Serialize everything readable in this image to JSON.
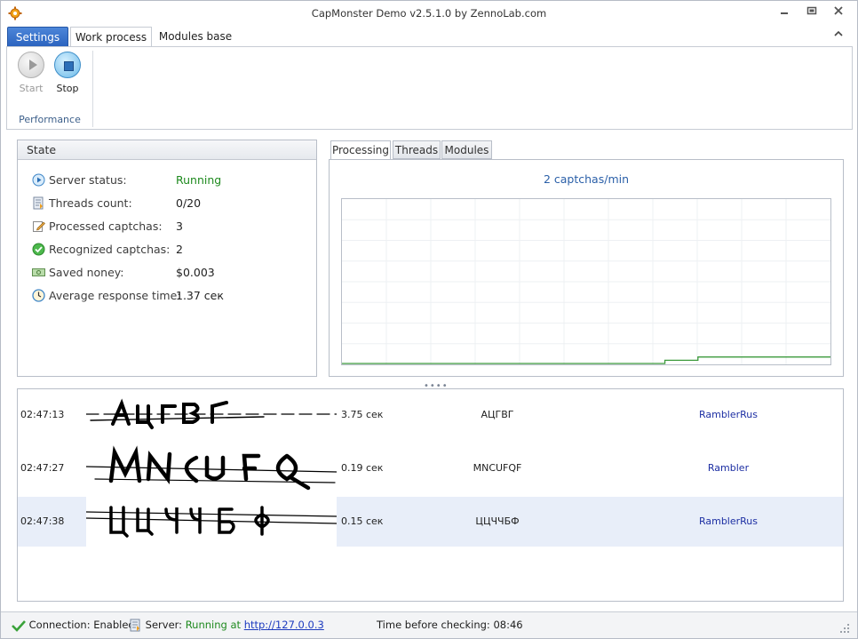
{
  "window": {
    "title": "CapMonster Demo v2.5.1.0 by ZennoLab.com",
    "controls": [
      "minimize-icon",
      "restore-icon",
      "close-icon"
    ]
  },
  "ribbon": {
    "tabs": [
      {
        "label": "Settings"
      },
      {
        "label": "Work process"
      },
      {
        "label": "Modules base"
      }
    ],
    "active_tab": "Work process",
    "group_label": "Performance",
    "start_label": "Start",
    "stop_label": "Stop"
  },
  "state": {
    "title": "State",
    "rows": [
      {
        "label": "Server status:",
        "value": "Running",
        "icon": "play-icon"
      },
      {
        "label": "Threads count:",
        "value": "0/20",
        "icon": "threads-icon"
      },
      {
        "label": "Processed captchas:",
        "value": "3",
        "icon": "edit-icon"
      },
      {
        "label": "Recognized captchas:",
        "value": "2",
        "icon": "check-icon"
      },
      {
        "label": "Saved noney:",
        "value": "$0.003",
        "icon": "money-icon"
      },
      {
        "label": "Average response time:",
        "value": "1.37 сек",
        "icon": "clock-icon"
      }
    ]
  },
  "processing": {
    "tabs": [
      {
        "label": "Processing"
      },
      {
        "label": "Threads"
      },
      {
        "label": "Modules"
      }
    ],
    "active_tab": "Processing",
    "rate": "2 captchas/min"
  },
  "chart_data": {
    "type": "line",
    "title": "",
    "xlabel": "",
    "ylabel": "",
    "grid": true,
    "series": [
      {
        "values": [
          0,
          0,
          0,
          0,
          0,
          0,
          0,
          0,
          0,
          0,
          0,
          0,
          0,
          0,
          0,
          0,
          0,
          0,
          0,
          0,
          0,
          0,
          0,
          0,
          0,
          0,
          0,
          0,
          0,
          0,
          0,
          0,
          0,
          0,
          0,
          0,
          0,
          0,
          0,
          1,
          1,
          1,
          1,
          2,
          2,
          2,
          2,
          2,
          2,
          2,
          2,
          2,
          2,
          2,
          2,
          2,
          2,
          2,
          2
        ]
      }
    ],
    "ylim": [
      0,
      50
    ],
    "color": "#3c9a3c"
  },
  "log": {
    "rows": [
      {
        "time": "02:47:13",
        "duration": "3.75 сек",
        "answer": "АЦГВГ",
        "module": "RamblerRus",
        "selected": false
      },
      {
        "time": "02:47:27",
        "duration": "0.19 сек",
        "answer": "MNCUFQF",
        "module": "Rambler",
        "selected": false
      },
      {
        "time": "02:47:38",
        "duration": "0.15 сек",
        "answer": "ЦЦЧЧБФ",
        "module": "RamblerRus",
        "selected": true
      }
    ]
  },
  "statusbar": {
    "connection": "Connection: Enabled",
    "server_label": "Server:",
    "server_status": "Running at",
    "server_url": "http://127.0.0.3",
    "timer": "Time before checking: 08:46"
  },
  "colors": {
    "accent": "#2a62be",
    "running": "#1f8a1f",
    "link": "#1d3bbf",
    "selected_row": "#e8eef9"
  }
}
